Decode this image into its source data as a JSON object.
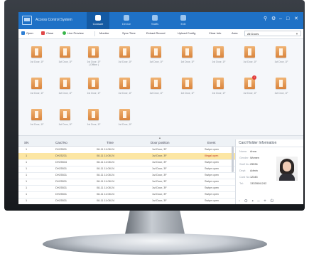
{
  "app": {
    "title": "Access Control System"
  },
  "nav_tabs": [
    {
      "label": "Console",
      "active": true
    },
    {
      "label": "Device"
    },
    {
      "label": "Staffs"
    },
    {
      "label": "Edit"
    }
  ],
  "window_controls": {
    "user": "⚲",
    "settings": "⚙",
    "minimize": "–",
    "maximize": "□",
    "close": "✕"
  },
  "toolbar": {
    "open": "Open",
    "close": "Close",
    "live_preview": "Live Preview",
    "monitor": "Monitor",
    "sync_time": "Sync Time",
    "extract_record": "Extract Record",
    "upload_config": "Upload Config",
    "clear_info": "Clear Info",
    "area_label": "Area",
    "area_value": "All Doors"
  },
  "doors": [
    {
      "label": "1st Door, 1F"
    },
    {
      "label": "1st Door, 1F"
    },
    {
      "label": "1st Door, 1F",
      "sub": "( Offline )"
    },
    {
      "label": "1st Door, 1F"
    },
    {
      "label": "1st Door, 1F"
    },
    {
      "label": "1st Door, 1F"
    },
    {
      "label": "1st Door, 1F"
    },
    {
      "label": "1st Door, 1F"
    },
    {
      "label": "1st Door, 1F"
    },
    {
      "label": "1st Door, 1F"
    },
    {
      "label": "1st Door, 1F"
    },
    {
      "label": "1st Door, 1F"
    },
    {
      "label": "1st Door, 1F"
    },
    {
      "label": "1st Door, 1F"
    },
    {
      "label": "1st Door, 1F"
    },
    {
      "label": "1st Door, 1F"
    },
    {
      "label": "1st Door, 1F",
      "alarm": "!"
    },
    {
      "label": "1st Door, 1F"
    },
    {
      "label": "1st Door, 1F"
    },
    {
      "label": "1st Door, 1F"
    },
    {
      "label": "1st Door, 1F"
    },
    {
      "label": "1st Door, 1F"
    }
  ],
  "events": {
    "columns": [
      "SN",
      "Card No",
      "Time",
      "Door position",
      "Event"
    ],
    "rows": [
      [
        "1",
        "DH25531",
        "08-11   11:08:24",
        "1st Door, 3F",
        "Swipe open"
      ],
      [
        "1",
        "DH25231",
        "08-11   11:08:24",
        "1st Door, 3F",
        "Illegal open"
      ],
      [
        "1",
        "DH25534",
        "08-11   11:08:24",
        "1st Door, 3F",
        "Swipe open"
      ],
      [
        "1",
        "DH25531",
        "08-11   11:08:24",
        "1st Door, 3F",
        "Swipe open"
      ],
      [
        "1",
        "DH25531",
        "08-11   11:08:24",
        "1st Door, 3F",
        "Swipe open"
      ],
      [
        "1",
        "DH25531",
        "08-11   11:08:24",
        "1st Door, 3F",
        "Swipe open"
      ],
      [
        "1",
        "DH25531",
        "08-11   11:08:24",
        "1st Door, 3F",
        "Swipe open"
      ],
      [
        "1",
        "DH25531",
        "08-11   11:08:24",
        "1st Door, 3F",
        "Swipe open"
      ],
      [
        "1",
        "DH25531",
        "08-11   11:08:24",
        "1st Door, 3F",
        "Swipe open"
      ]
    ]
  },
  "card_holder": {
    "title": "Card Holder Information",
    "fields": [
      {
        "k": "Name:",
        "v": "Anna"
      },
      {
        "k": "Gender:",
        "v": "Women"
      },
      {
        "k": "Staff No:",
        "v": "25536"
      },
      {
        "k": "Dept:",
        "v": "Admin"
      },
      {
        "k": "Card No:",
        "v": "12345"
      },
      {
        "k": "Tel:",
        "v": "13328541242"
      }
    ]
  },
  "bezel": {
    "controls": "◦ ⊙ ▪ – + ⏻"
  }
}
